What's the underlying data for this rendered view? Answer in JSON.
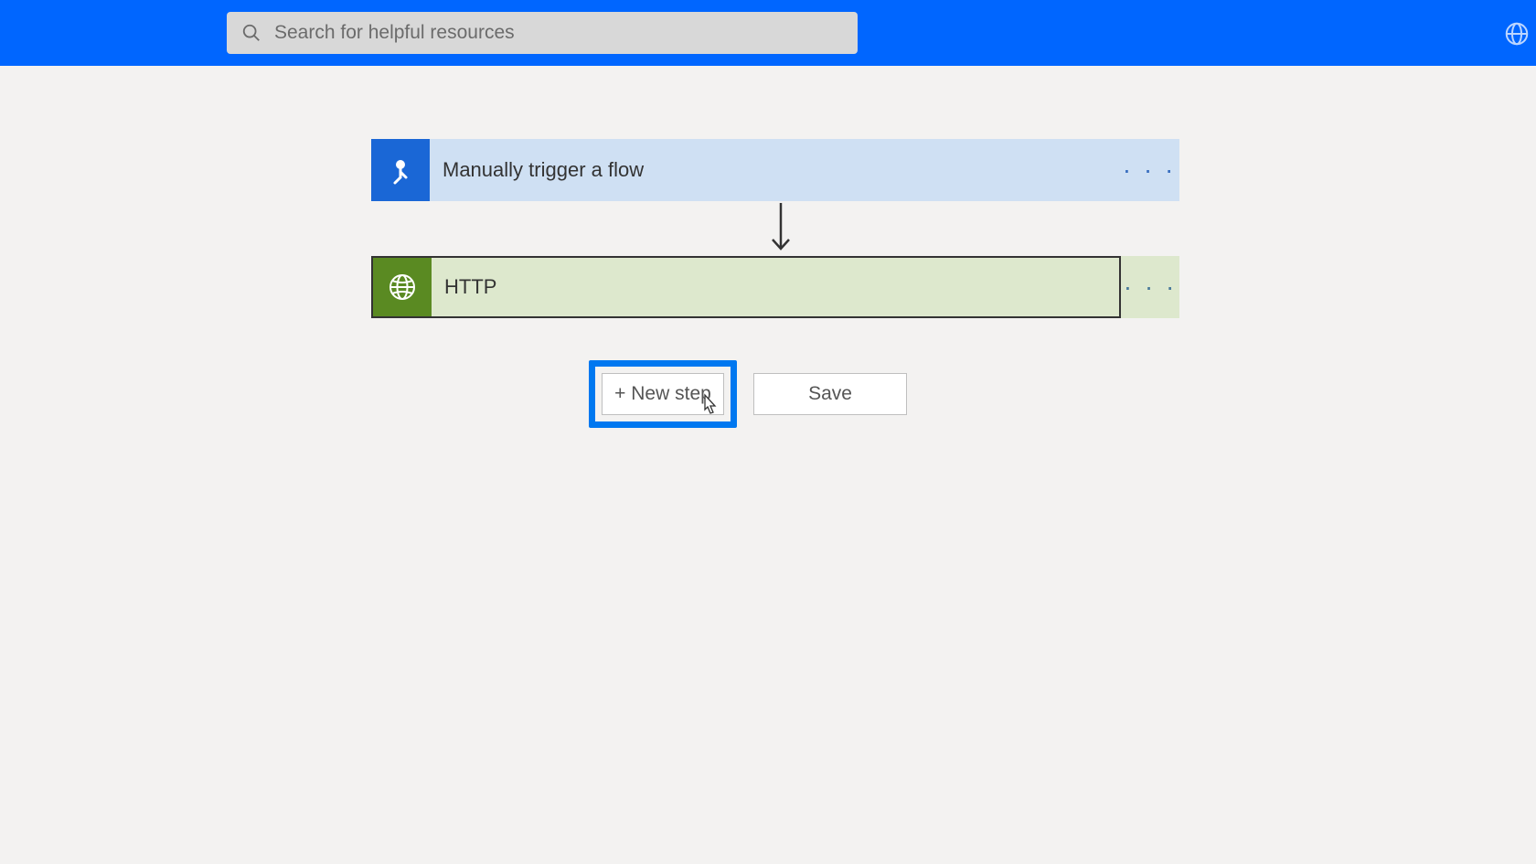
{
  "header": {
    "search_placeholder": "Search for helpful resources"
  },
  "flow": {
    "trigger": {
      "title": "Manually trigger a flow",
      "icon": "touch-pointer-icon",
      "more": "· · ·"
    },
    "action1": {
      "title": "HTTP",
      "icon": "globe-icon",
      "more": "· · ·"
    }
  },
  "buttons": {
    "new_step": "+ New step",
    "save": "Save"
  }
}
